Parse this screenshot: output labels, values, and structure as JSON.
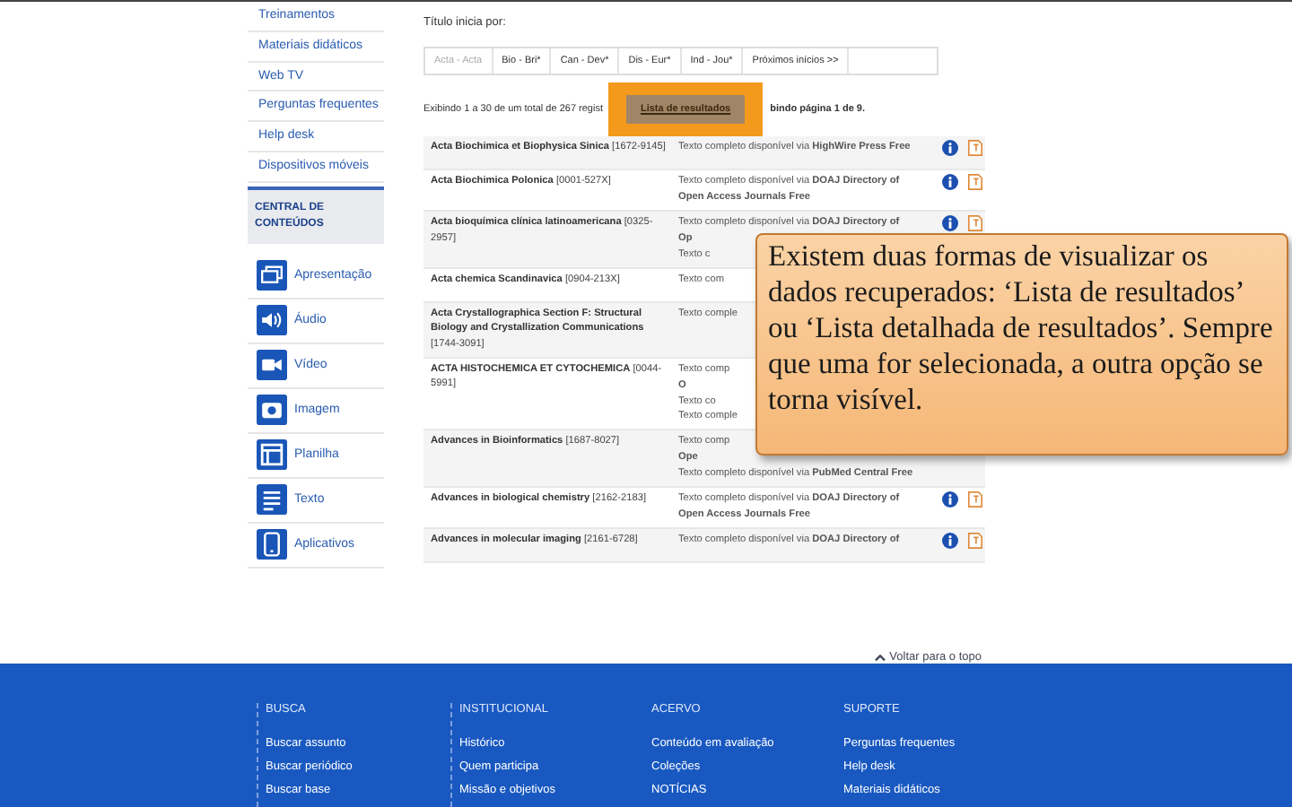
{
  "sidebar": {
    "links": [
      "Treinamentos",
      "Materiais didáticos",
      "Web TV",
      "Perguntas frequentes",
      "Help desk",
      "Dispositivos móveis"
    ],
    "section_title": "CENTRAL DE CONTEÚDOS",
    "content_items": [
      {
        "kind": "presentation",
        "label": "Apresentação"
      },
      {
        "kind": "audio",
        "label": "Áudio"
      },
      {
        "kind": "video",
        "label": "Vídeo"
      },
      {
        "kind": "image",
        "label": "Imagem"
      },
      {
        "kind": "spreadsheet",
        "label": "Planilha"
      },
      {
        "kind": "text",
        "label": "Texto"
      },
      {
        "kind": "apps",
        "label": "Aplicativos"
      }
    ]
  },
  "filter": {
    "label": "Título inicia por:",
    "ranges": [
      {
        "label": "Acta - Acta",
        "selected": true
      },
      {
        "label": "Bio - Bri*",
        "selected": false
      },
      {
        "label": "Can - Dev*",
        "selected": false
      },
      {
        "label": "Dis - Eur*",
        "selected": false
      },
      {
        "label": "Ind - Jou*",
        "selected": false
      },
      {
        "label": "Próximos inícios >>",
        "selected": false
      }
    ]
  },
  "results_info": {
    "before": "Exibindo 1 a 30 de um total de 267 regist",
    "button": "Lista de resultados",
    "after": "bindo página 1 de 9."
  },
  "rows": [
    {
      "title": "Acta Biochimica et Biophysica Sinica",
      "issn": "[1672-9145]",
      "access": [
        "Texto completo disponível via **HighWire Press Free**"
      ],
      "actions": [
        {
          "kind": "info"
        },
        {
          "kind": "document"
        }
      ]
    },
    {
      "title": "Acta Biochimica Polonica",
      "issn": "[0001-527X]",
      "access": [
        "Texto completo disponível via **DOAJ Directory of**",
        "**Open Access Journals Free**"
      ],
      "actions": [
        {
          "kind": "info"
        },
        {
          "kind": "document"
        }
      ]
    },
    {
      "title": "Acta bioquímica clínica latinoamericana",
      "issn": "[0325-2957]",
      "access": [
        "Texto completo disponível via **DOAJ Directory of**",
        "**Op**",
        "Texto c"
      ],
      "actions": [
        {
          "kind": "info"
        },
        {
          "kind": "document"
        }
      ]
    },
    {
      "title": "Acta chemica Scandinavica",
      "issn": "[0904-213X]",
      "access": [
        "Texto com"
      ]
    },
    {
      "title": "Acta Crystallographica Section F: Structural Biology and Crystallization Communications",
      "issn": "[1744-3091]",
      "access": [
        "Texto comple"
      ]
    },
    {
      "title": "ACTA HISTOCHEMICA ET CYTOCHEMICA",
      "issn": "[0044-5991]",
      "access": [
        "Texto comp",
        "**O**",
        "Texto co",
        "Texto comple"
      ]
    },
    {
      "title": "Advances in Bioinformatics",
      "issn": "[1687-8027]",
      "access": [
        "Texto comp",
        "**Ope**",
        "Texto completo disponível via **PubMed Central Free**"
      ]
    },
    {
      "title": "Advances in biological chemistry",
      "issn": "[2162-2183]",
      "access": [
        "Texto completo disponível via **DOAJ Directory of**",
        "**Open Access Journals Free**"
      ],
      "actions": [
        {
          "kind": "info"
        },
        {
          "kind": "document"
        }
      ]
    },
    {
      "title": "Advances in molecular imaging",
      "issn": "[2161-6728]",
      "access": [
        "Texto completo disponível via **DOAJ Directory of**"
      ],
      "actions": [
        {
          "kind": "info"
        },
        {
          "kind": "document"
        }
      ]
    }
  ],
  "back_to_top": "Voltar para o topo",
  "callout": "Existem duas formas de visualizar os dados recuperados: ‘Lista de resultados’ ou ‘Lista detalhada de resultados’. Sempre que uma for selecionada, a outra opção se torna visível.",
  "footer": [
    {
      "title": "BUSCA",
      "links": [
        "Buscar assunto",
        "Buscar periódico",
        "Buscar base"
      ]
    },
    {
      "title": "INSTITUCIONAL",
      "links": [
        "Histórico",
        "Quem participa",
        "Missão e objetivos"
      ]
    },
    {
      "title": "ACERVO",
      "links": [
        "Conteúdo em avaliação",
        "Coleções",
        "NOTÍCIAS"
      ]
    },
    {
      "title": "SUPORTE",
      "links": [
        "Perguntas frequentes",
        "Help desk",
        "Materiais didáticos"
      ]
    }
  ]
}
